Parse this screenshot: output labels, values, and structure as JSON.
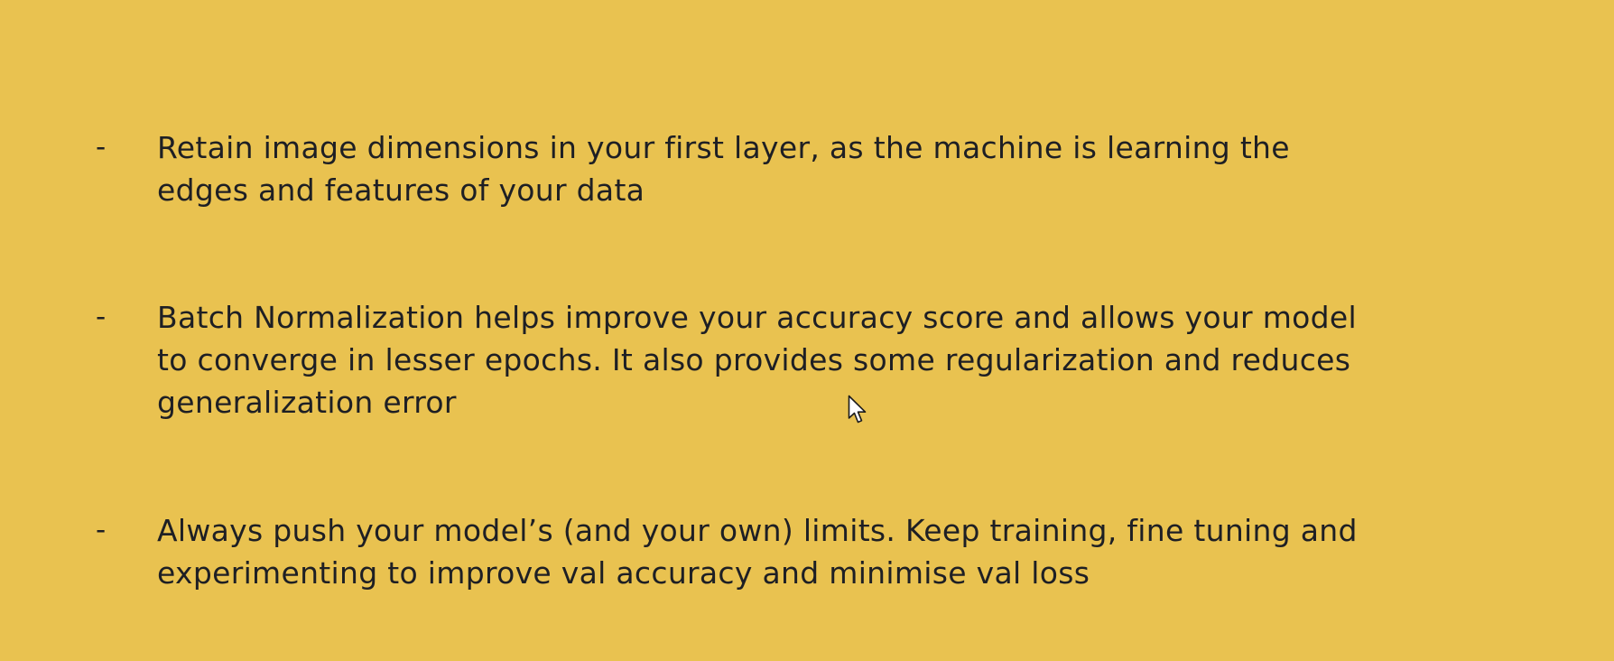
{
  "slide": {
    "background_color": "#e9c250",
    "text_color": "#1e1f24",
    "bullets": [
      {
        "marker": "-",
        "lines": [
          "Retain image dimensions in your first layer, as the machine is learning the",
          "edges and features of your data"
        ]
      },
      {
        "marker": "-",
        "lines": [
          "Batch Normalization helps improve your accuracy score and allows your model",
          "to converge in lesser epochs. It also provides some regularization and reduces",
          "generalization error"
        ]
      },
      {
        "marker": "-",
        "lines": [
          "Always push your model’s (and your own)  limits. Keep training, fine tuning and",
          "experimenting to improve val accuracy and minimise val loss"
        ]
      }
    ]
  },
  "cursor": {
    "icon": "mouse-pointer-icon"
  }
}
